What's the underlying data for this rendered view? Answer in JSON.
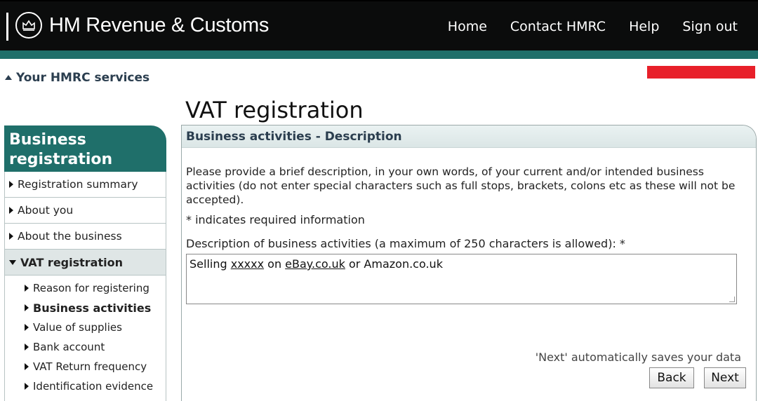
{
  "header": {
    "brand": "HM Revenue & Customs",
    "nav": [
      "Home",
      "Contact HMRC",
      "Help",
      "Sign out"
    ],
    "colors": {
      "bar": "#0b0c0c",
      "stripe": "#1f6f6a"
    }
  },
  "services_link": "Your HMRC services",
  "sidebar": {
    "title": "Business registration",
    "items": [
      {
        "label": "Registration summary"
      },
      {
        "label": "About you"
      },
      {
        "label": "About the business"
      },
      {
        "label": "VAT registration"
      }
    ],
    "subitems": [
      {
        "label": "Reason for registering"
      },
      {
        "label": "Business activities"
      },
      {
        "label": "Value of supplies"
      },
      {
        "label": "Bank account"
      },
      {
        "label": "VAT Return frequency"
      },
      {
        "label": "Identification evidence"
      }
    ]
  },
  "main": {
    "page_title": "VAT registration",
    "section_title": "Business activities - Description",
    "intro": "Please provide a brief description, in your own words, of your current and/or intended business activities (do not enter special characters such as full stops, brackets, colons etc as these will not be accepted).",
    "required_note": "* indicates required information",
    "field_label": "Description of business activities (a maximum of 250 characters is allowed): *",
    "field_value": {
      "part1": "Selling ",
      "part2": "xxxxx",
      "part3": " on ",
      "part4": "eBay.co.uk",
      "part5": " or Amazon.co.uk"
    },
    "autosave_note": "'Next' automatically saves your data",
    "back_label": "Back",
    "next_label": "Next"
  }
}
